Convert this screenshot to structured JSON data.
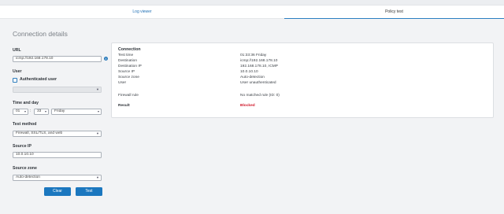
{
  "tabs": [
    {
      "label": "Log viewer"
    },
    {
      "label": "Policy test"
    }
  ],
  "form": {
    "title": "Connection details",
    "url_label": "URL",
    "url_value": "icmp://192.168.178.10",
    "info_icon": "info-icon",
    "user_label": "User",
    "auth_label": "Authenticated user",
    "auth_checked": false,
    "user_select_value": "",
    "time_label": "Time and day",
    "hour": "01",
    "minute": "33",
    "day": "Friday",
    "test_method_label": "Test method",
    "test_method_value": "Firewall, SSL/TLS, and web",
    "source_ip_label": "Source IP",
    "source_ip_value": "10.0.10.10",
    "source_zone_label": "Source zone",
    "source_zone_value": "Auto-detection",
    "clear_label": "Clear",
    "test_label": "Test"
  },
  "result": {
    "title": "Connection",
    "rows": [
      {
        "key": "Test time",
        "value": "01:33:36 Friday"
      },
      {
        "key": "Destination",
        "value": "icmp://192.168.178.10"
      },
      {
        "key": "Destination IP",
        "value": "192.168.178.10, ICMP"
      },
      {
        "key": "Source IP",
        "value": "10.0.10.10"
      },
      {
        "key": "Source zone",
        "value": "Auto-detection"
      },
      {
        "key": "User",
        "value": "User unauthenticated"
      }
    ],
    "firewall_rule_key": "Firewall rule",
    "firewall_rule_value": "No matched rule (ID: 0)",
    "result_key": "Result",
    "result_value": "Blocked",
    "blocked_color": "#d0182a"
  }
}
